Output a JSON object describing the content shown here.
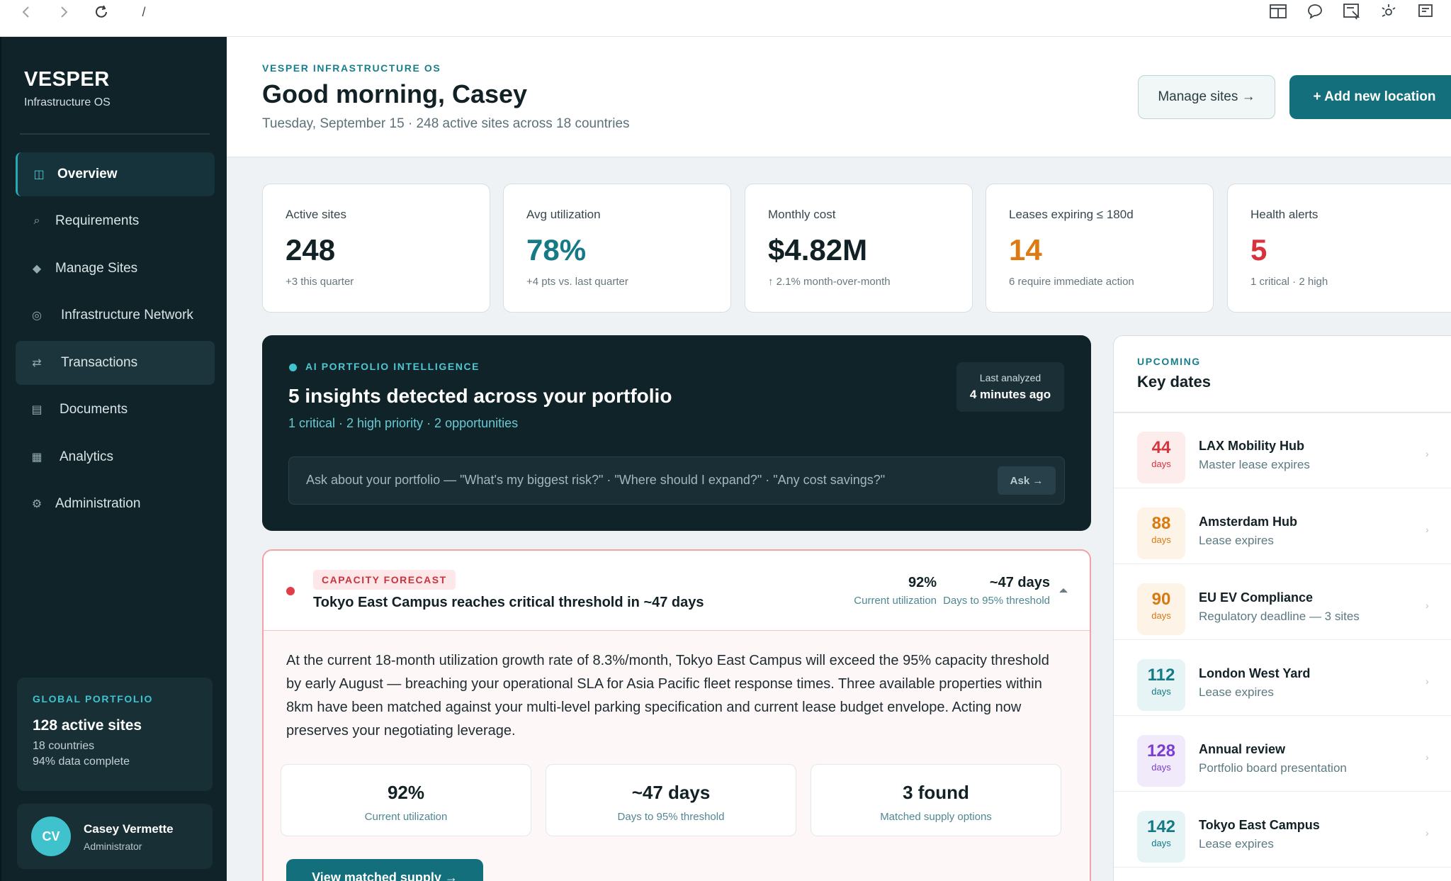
{
  "browser": {
    "path": "/"
  },
  "sidebar": {
    "brand": "VESPER",
    "brand_sub": "Infrastructure OS",
    "items": [
      {
        "label": "Overview",
        "icon": "layout-icon"
      },
      {
        "label": "Requirements",
        "icon": "search-icon"
      },
      {
        "label": "Manage Sites",
        "icon": "diamond-icon"
      },
      {
        "label": "Infrastructure Network",
        "icon": "network-icon"
      },
      {
        "label": "Transactions",
        "icon": "swap-icon"
      },
      {
        "label": "Documents",
        "icon": "document-icon"
      },
      {
        "label": "Analytics",
        "icon": "grid-icon"
      },
      {
        "label": "Administration",
        "icon": "gear-icon"
      }
    ],
    "portfolio": {
      "label": "GLOBAL PORTFOLIO",
      "title": "128 active sites",
      "countries": "18 countries",
      "complete": "94% data complete"
    },
    "user": {
      "initials": "CV",
      "name": "Casey Vermette",
      "role": "Administrator"
    }
  },
  "header": {
    "eyebrow": "VESPER INFRASTRUCTURE OS",
    "greeting": "Good morning, Casey",
    "subline": "Tuesday, September 15 · 248 active sites across 18 countries",
    "manage_label": "Manage sites →",
    "add_label": "+ Add new location"
  },
  "stats": [
    {
      "label": "Active sites",
      "value": "248",
      "note": "+3 this quarter",
      "color": "#122126"
    },
    {
      "label": "Avg utilization",
      "value": "78%",
      "note": "+4 pts vs. last quarter",
      "color": "#157a86"
    },
    {
      "label": "Monthly cost",
      "value": "$4.82M",
      "note": "↑ 2.1% month-over-month",
      "color": "#122126"
    },
    {
      "label": "Leases expiring ≤ 180d",
      "value": "14",
      "note": "6 require immediate action",
      "color": "#dd7a12"
    },
    {
      "label": "Health alerts",
      "value": "5",
      "note": "1 critical · 2 high",
      "color": "#d8323d"
    }
  ],
  "ai": {
    "eyebrow": "AI PORTFOLIO INTELLIGENCE",
    "title": "5 insights detected across your portfolio",
    "subtitle": "1 critical · 2 high priority · 2 opportunities",
    "last_label": "Last analyzed",
    "last_value": "4 minutes ago",
    "ask_placeholder": "Ask about your portfolio — \"What's my biggest risk?\" · \"Where should I expand?\" · \"Any cost savings?\"",
    "ask_button": "Ask →"
  },
  "forecast": {
    "tag": "CAPACITY FORECAST",
    "title": "Tokyo East Campus reaches critical threshold in ~47 days",
    "metric1_value": "92%",
    "metric1_label": "Current utilization",
    "metric2_value": "~47 days",
    "metric2_label": "Days to 95% threshold",
    "body": "At the current 18-month utilization growth rate of 8.3%/month, Tokyo East Campus will exceed the 95% capacity threshold by early August — breaching your operational SLA for Asia Pacific fleet response times. Three available properties within 8km have been matched against your multi-level parking specification and current lease budget envelope. Acting now preserves your negotiating leverage.",
    "cards": [
      {
        "value": "92%",
        "label": "Current utilization"
      },
      {
        "value": "~47 days",
        "label": "Days to 95% threshold"
      },
      {
        "value": "3 found",
        "label": "Matched supply options"
      }
    ],
    "cta": "View matched supply →"
  },
  "keydates": {
    "eyebrow": "UPCOMING",
    "title": "Key dates",
    "items": [
      {
        "days": "44",
        "unit": "days",
        "name": "LAX Mobility Hub",
        "desc": "Master lease expires",
        "fg": "#d8323d",
        "bg": "#fdecec"
      },
      {
        "days": "88",
        "unit": "days",
        "name": "Amsterdam Hub",
        "desc": "Lease expires",
        "fg": "#d77a12",
        "bg": "#fdf3e7"
      },
      {
        "days": "90",
        "unit": "days",
        "name": "EU EV Compliance",
        "desc": "Regulatory deadline — 3 sites",
        "fg": "#d77a12",
        "bg": "#fdf3e7"
      },
      {
        "days": "112",
        "unit": "days",
        "name": "London West Yard",
        "desc": "Lease expires",
        "fg": "#157a86",
        "bg": "#e6f4f5"
      },
      {
        "days": "128",
        "unit": "days",
        "name": "Annual review",
        "desc": "Portfolio board presentation",
        "fg": "#7a3fd1",
        "bg": "#f1eafb"
      },
      {
        "days": "142",
        "unit": "days",
        "name": "Tokyo East Campus",
        "desc": "Lease expires",
        "fg": "#157a86",
        "bg": "#e6f4f5"
      }
    ]
  }
}
